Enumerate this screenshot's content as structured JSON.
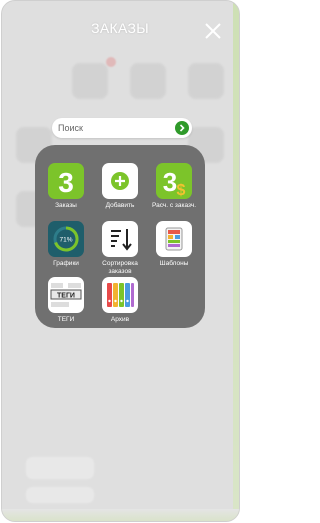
{
  "header": {
    "title": "ЗАКАЗЫ"
  },
  "search": {
    "placeholder": "Поиск"
  },
  "apps": [
    {
      "label": "Заказы",
      "icon": "number-three-icon"
    },
    {
      "label": "Добавить",
      "icon": "plus-circle-icon"
    },
    {
      "label": "Расч. с заказч.",
      "icon": "three-dollar-icon"
    },
    {
      "label": "Графики",
      "icon": "progress-ring-icon",
      "value_text": "71%"
    },
    {
      "label": "Сортировка заказов",
      "icon": "sort-arrows-icon"
    },
    {
      "label": "Шаблоны",
      "icon": "templates-icon"
    },
    {
      "label": "ТЕГИ",
      "icon": "tags-icon",
      "tag_text": "ТЕГИ"
    },
    {
      "label": "Архив",
      "icon": "archive-binders-icon"
    }
  ],
  "colors": {
    "accent_green": "#7cc42a",
    "search_button": "#2f9a2a",
    "panel": "#707070"
  }
}
